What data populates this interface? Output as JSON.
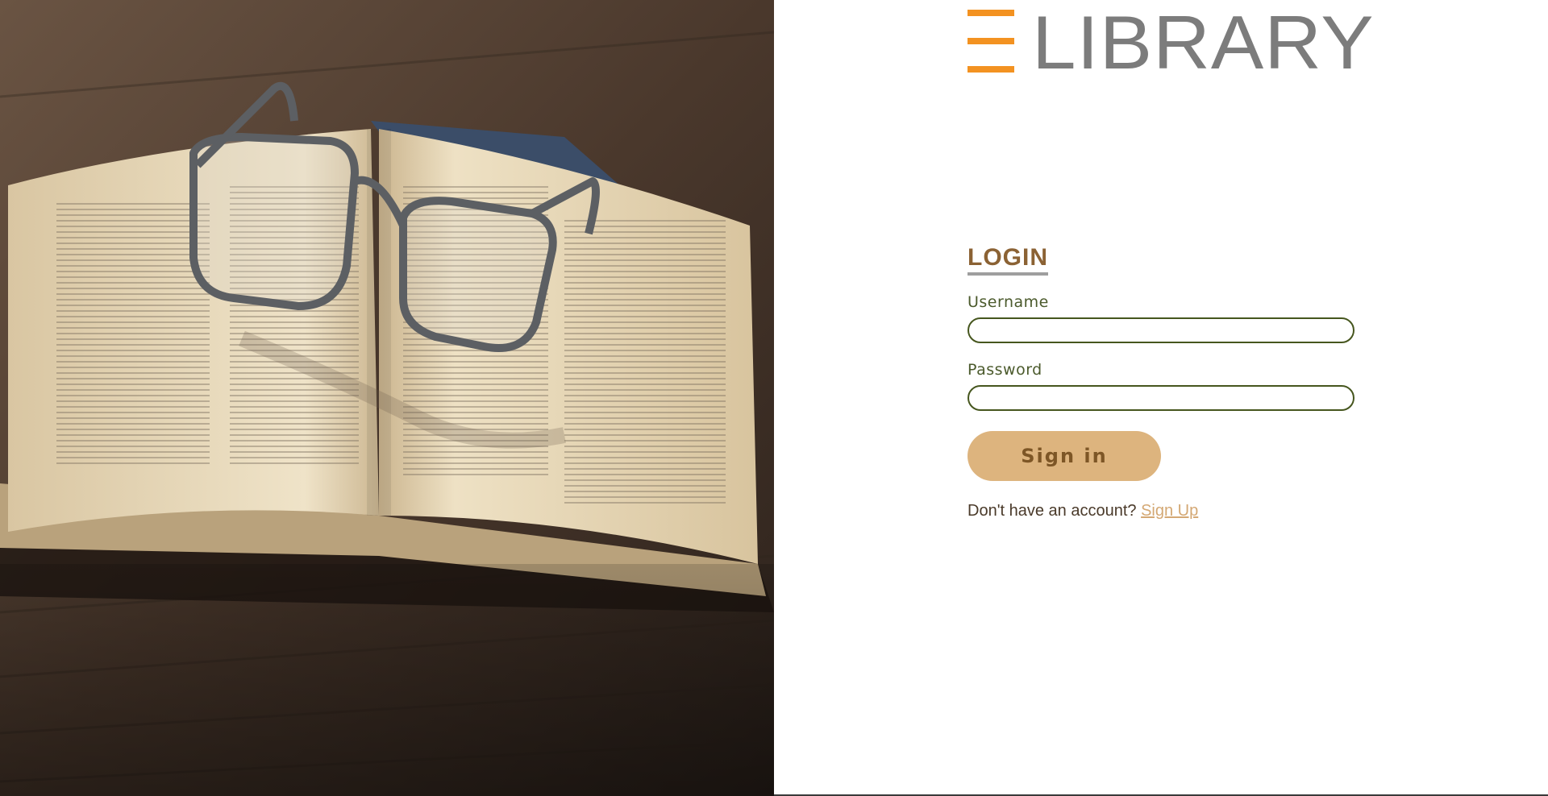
{
  "logo": {
    "text": "LIBRARY",
    "accent_color": "#f39221",
    "text_color": "#7c7c7c"
  },
  "hero_image": {
    "description_icon": "book-with-glasses-photo"
  },
  "login": {
    "title": "LOGIN",
    "username_label": "Username",
    "username_value": "",
    "password_label": "Password",
    "password_value": "",
    "signin_label": "Sign in",
    "signup_prompt": "Don't have an account?",
    "signup_link": "Sign Up"
  },
  "colors": {
    "title": "#8b6234",
    "label": "#4b5a2c",
    "input_border": "#46561e",
    "button_bg": "#ddb47e",
    "button_text": "#7d5626",
    "link": "#d4a874"
  }
}
